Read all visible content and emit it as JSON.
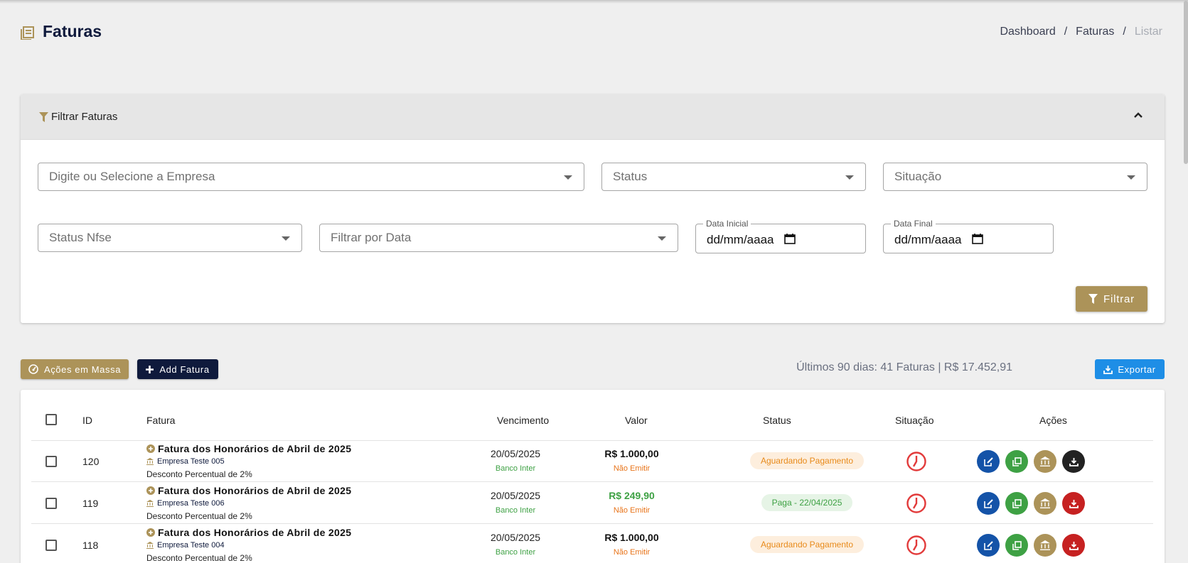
{
  "header": {
    "title": "Faturas",
    "breadcrumb": [
      "Dashboard",
      "Faturas",
      "Listar"
    ]
  },
  "filter": {
    "title": "Filtrar Faturas",
    "fields": {
      "empresa_placeholder": "Digite ou Selecione a Empresa",
      "status_placeholder": "Status",
      "situacao_placeholder": "Situação",
      "status_nfse_placeholder": "Status Nfse",
      "filtrar_data_placeholder": "Filtrar por Data",
      "data_inicial_label": "Data Inicial",
      "data_inicial_value": "dd/mm/aaaa",
      "data_final_label": "Data Final",
      "data_final_value": "dd/mm/aaaa"
    },
    "submit_label": "Filtrar"
  },
  "toolbar": {
    "mass_actions_label": "Ações em Massa",
    "add_label": "Add Fatura",
    "summary": "Últimos 90 dias: 41 Faturas | R$ 17.452,91",
    "export_label": "Exportar"
  },
  "table": {
    "columns": [
      "ID",
      "Fatura",
      "Vencimento",
      "Valor",
      "Status",
      "Situação",
      "Ações"
    ],
    "rows": [
      {
        "id": "120",
        "title": "Fatura dos Honorários de Abril de 2025",
        "company": "Empresa Teste 005",
        "desc": "Desconto Percentual de 2%",
        "vencimento": "20/05/2025",
        "bank": "Banco Inter",
        "valor": "R$ 1.000,00",
        "nfse": "Não Emitir",
        "status": "Aguardando Pagamento",
        "status_type": "wait",
        "download_color": "#222222"
      },
      {
        "id": "119",
        "title": "Fatura dos Honorários de Abril de 2025",
        "company": "Empresa Teste 006",
        "desc": "Desconto Percentual de 2%",
        "vencimento": "20/05/2025",
        "bank": "Banco Inter",
        "valor": "R$ 249,90",
        "nfse": "Não Emitir",
        "status": "Paga - 22/04/2025",
        "status_type": "paid",
        "download_color": "#c62121"
      },
      {
        "id": "118",
        "title": "Fatura dos Honorários de Abril de 2025",
        "company": "Empresa Teste 004",
        "desc": "Desconto Percentual de 2%",
        "vencimento": "20/05/2025",
        "bank": "Banco Inter",
        "valor": "R$ 1.000,00",
        "nfse": "Não Emitir",
        "status": "Aguardando Pagamento",
        "status_type": "wait",
        "download_color": "#c62121"
      }
    ]
  },
  "colors": {
    "brand_gold": "#ac9359",
    "brand_navy": "#0f1a3c",
    "export_blue": "#1e8ee6",
    "status_wait": "#e88a1a",
    "status_paid": "#3ea144"
  }
}
